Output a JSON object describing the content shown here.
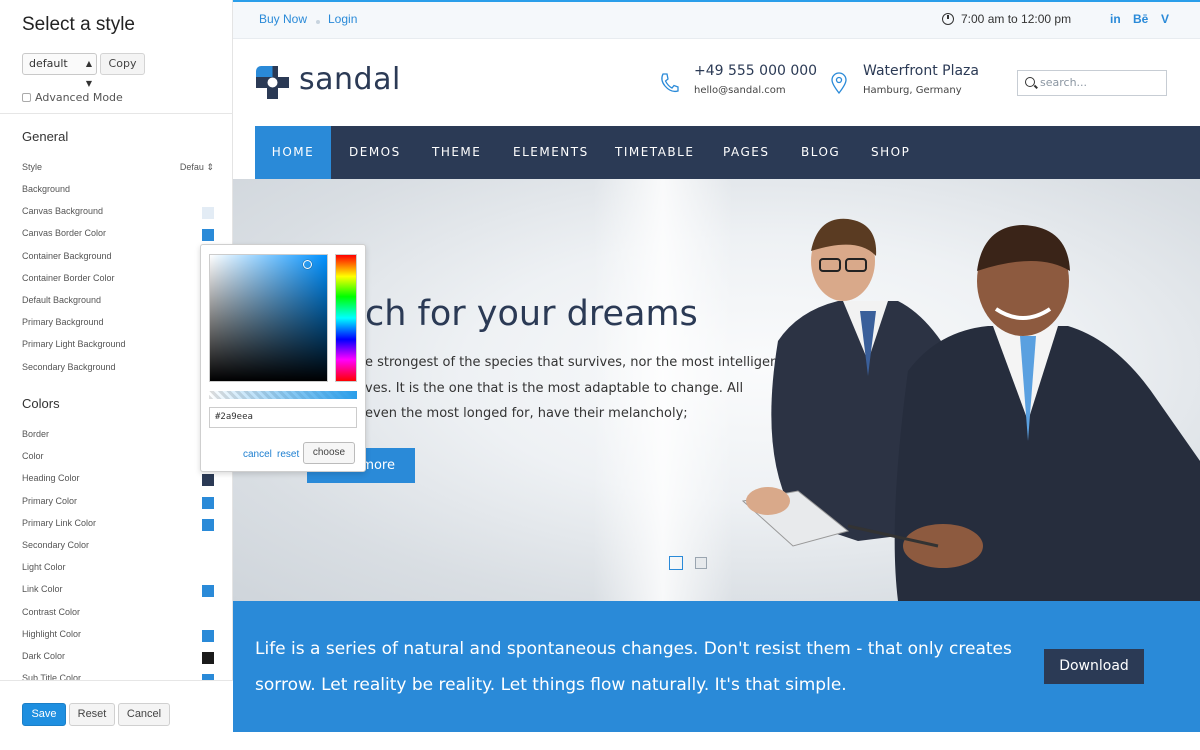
{
  "panel": {
    "title": "Select a style",
    "style_select": "default",
    "copy_label": "Copy",
    "advanced_label": "Advanced Mode",
    "general": {
      "heading": "General",
      "style_label": "Style",
      "style_value": "Defau",
      "rows": [
        {
          "label": "Background"
        },
        {
          "label": "Canvas Background",
          "color": "#e3ecf5"
        },
        {
          "label": "Canvas Border Color",
          "color": "#2a8ad8"
        },
        {
          "label": "Container Background"
        },
        {
          "label": "Container Border Color"
        },
        {
          "label": "Default Background"
        },
        {
          "label": "Primary Background"
        },
        {
          "label": "Primary Light Background"
        },
        {
          "label": "Secondary Background"
        }
      ]
    },
    "colors": {
      "heading": "Colors",
      "rows": [
        {
          "label": "Border"
        },
        {
          "label": "Color"
        },
        {
          "label": "Heading Color",
          "color": "#2b3a55"
        },
        {
          "label": "Primary Color",
          "color": "#2a8ad8"
        },
        {
          "label": "Primary Link Color",
          "color": "#2a8ad8"
        },
        {
          "label": "Secondary Color"
        },
        {
          "label": "Light Color"
        },
        {
          "label": "Link Color",
          "color": "#2a8ad8"
        },
        {
          "label": "Contrast Color"
        },
        {
          "label": "Highlight Color",
          "color": "#2a8ad8"
        },
        {
          "label": "Dark Color",
          "color": "#1a1a1a"
        },
        {
          "label": "Sub Title Color",
          "color": "#2a8ad8"
        }
      ]
    },
    "footer": {
      "save": "Save",
      "reset": "Reset",
      "cancel": "Cancel"
    }
  },
  "picker": {
    "hex": "#2a9eea",
    "cancel": "cancel",
    "reset": "reset",
    "choose": "choose"
  },
  "topbar": {
    "buy_now": "Buy Now",
    "login": "Login",
    "hours": "7:00 am to 12:00 pm",
    "social": [
      "in",
      "Bē",
      "V"
    ]
  },
  "header": {
    "logo": "sandal",
    "phone": "+49 555 000 000",
    "email": "hello@sandal.com",
    "place": "Waterfront Plaza",
    "city": "Hamburg, Germany",
    "search_placeholder": "search..."
  },
  "nav": {
    "items": [
      "HOME",
      "DEMOS",
      "THEME",
      "ELEMENTS",
      "TIMETABLE",
      "PAGES",
      "BLOG",
      "SHOP"
    ]
  },
  "hero": {
    "title": "ch for your dreams",
    "lines": [
      "e strongest of the species that survives, nor the most intelligent",
      "ves. It is the one that is the most adaptable to change. All",
      "even the most longed for, have their melancholy;"
    ],
    "button": "more"
  },
  "quote": {
    "lines": [
      "Life is a series of natural and spontaneous changes. Don't resist them - that only creates",
      "sorrow. Let reality be reality. Let things flow naturally. It's that simple."
    ],
    "button": "Download"
  },
  "colors": {
    "accent": "#2a8ad8",
    "navy": "#2b3a55"
  }
}
